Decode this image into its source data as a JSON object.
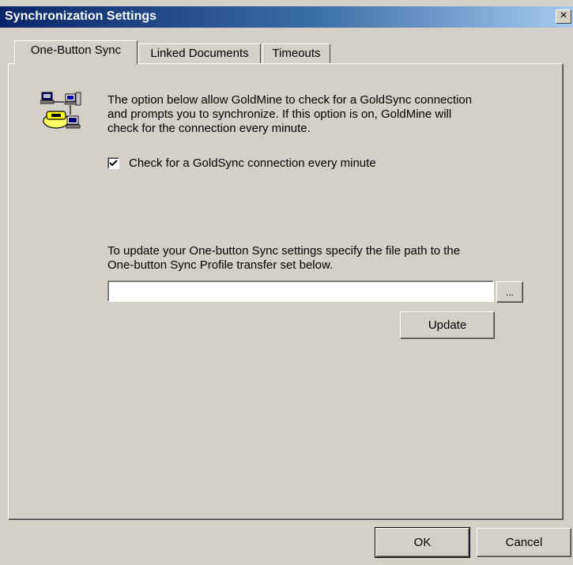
{
  "window": {
    "title": "Synchronization Settings",
    "close_label": "×"
  },
  "tabs": [
    {
      "label": "One-Button Sync",
      "active": true
    },
    {
      "label": "Linked Documents",
      "active": false
    },
    {
      "label": "Timeouts",
      "active": false
    }
  ],
  "one_button_sync": {
    "icon": "network-sync-icon",
    "description": "The option below allow GoldMine to check for a GoldSync connection\nand prompts you to synchronize.  If this option is on, GoldMine will\ncheck for the connection every minute.",
    "check_label": "Check for a GoldSync connection every minute",
    "check_value": true,
    "profile_description": "To update your One-button Sync settings specify the file path to the\nOne-button Sync Profile transfer set below.",
    "path_value": "",
    "browse_label": "...",
    "update_label": "Update"
  },
  "footer": {
    "ok_label": "OK",
    "cancel_label": "Cancel"
  }
}
